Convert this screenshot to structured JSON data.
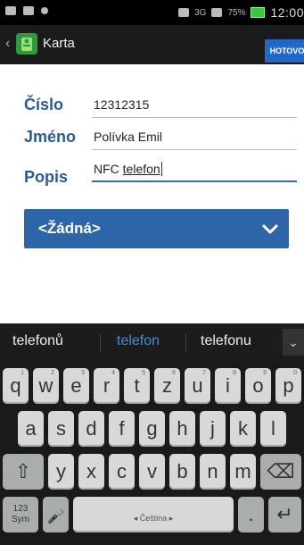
{
  "status": {
    "network": "3G",
    "percent": "75%",
    "time": "12:00"
  },
  "actionbar": {
    "back": "‹",
    "title": "Karta",
    "done_label": "HOTOVO"
  },
  "form": {
    "fields": [
      {
        "label": "Číslo",
        "value": "12312315"
      },
      {
        "label": "Jméno",
        "value": "Polívka Emil"
      },
      {
        "label": "Popis",
        "value_prefix": "NFC ",
        "value_word": "telefon"
      }
    ],
    "dropdown": {
      "selected": "<Žádná>"
    }
  },
  "suggestions": [
    "telefonů",
    "telefon",
    "telefonu"
  ],
  "keyboard": {
    "row1": [
      "q",
      "w",
      "e",
      "r",
      "t",
      "z",
      "u",
      "i",
      "o",
      "p"
    ],
    "row1_alt": [
      "1",
      "2",
      "3",
      "4",
      "5",
      "6",
      "7",
      "8",
      "9",
      "0"
    ],
    "row2": [
      "a",
      "s",
      "d",
      "f",
      "g",
      "h",
      "j",
      "k",
      "l"
    ],
    "row3": [
      "y",
      "x",
      "c",
      "v",
      "b",
      "n",
      "m"
    ],
    "shift": "⇧",
    "backspace": "⌫",
    "sym_label": "123\nSym",
    "mic": "🎤",
    "space_label": "◂  Čeština  ▸",
    "period": ".",
    "enter": "↵"
  },
  "colors": {
    "accent": "#2d66a8",
    "label": "#2a5a9a",
    "suggest_active": "#3b8fe0"
  }
}
